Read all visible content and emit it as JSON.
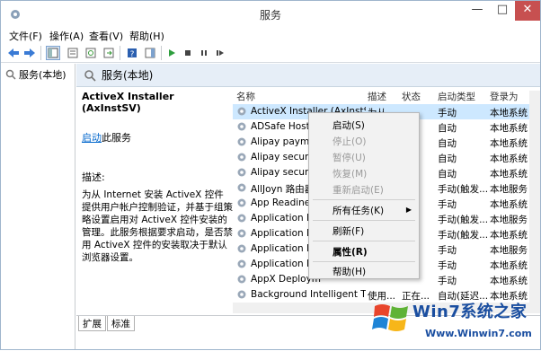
{
  "window": {
    "title": "服务",
    "min": "—",
    "max": "□",
    "close": "✕"
  },
  "menu": [
    "文件(F)",
    "操作(A)",
    "查看(V)",
    "帮助(H)"
  ],
  "tree": {
    "item": "服务(本地)"
  },
  "panel": {
    "header": "服务(本地)"
  },
  "details": {
    "service_title": "ActiveX Installer (AxInstSV)",
    "start_link": "启动",
    "start_suffix": "此服务",
    "desc_label": "描述:",
    "desc_text": "为从 Internet 安装 ActiveX 控件提供用户帐户控制验证，并基于组策略设置启用对 ActiveX 控件安装的管理。此服务根据要求启动，是否禁用 ActiveX 控件的安装取决于默认浏览器设置。"
  },
  "columns": {
    "name": "名称",
    "desc": "描述",
    "status": "状态",
    "startup": "启动类型",
    "logon": "登录为"
  },
  "rows": [
    {
      "name": "ActiveX Installer (AxInstSV)",
      "desc": "为从...",
      "status": "",
      "startup": "手动",
      "logon": "本地系统"
    },
    {
      "name": "ADSafe Host S",
      "desc": "",
      "status": "",
      "startup": "自动",
      "logon": "本地系统"
    },
    {
      "name": "Alipay paymer",
      "desc": "",
      "status": "",
      "startup": "自动",
      "logon": "本地系统"
    },
    {
      "name": "Alipay security",
      "desc": "",
      "status": "",
      "startup": "自动",
      "logon": "本地系统"
    },
    {
      "name": "Alipay security",
      "desc": "",
      "status": "",
      "startup": "自动",
      "logon": "本地系统"
    },
    {
      "name": "AllJoyn 路由器",
      "desc": "",
      "status": "",
      "startup": "手动(触发...",
      "logon": "本地服务"
    },
    {
      "name": "App Readines",
      "desc": "",
      "status": "",
      "startup": "手动",
      "logon": "本地系统"
    },
    {
      "name": "Application Id",
      "desc": "",
      "status": "",
      "startup": "手动(触发...",
      "logon": "本地服务"
    },
    {
      "name": "Application Inf",
      "desc": "",
      "status": "",
      "startup": "手动(触发...",
      "logon": "本地系统"
    },
    {
      "name": "Application La",
      "desc": "",
      "status": "",
      "startup": "手动",
      "logon": "本地服务"
    },
    {
      "name": "Application M",
      "desc": "",
      "status": "",
      "startup": "手动",
      "logon": "本地系统"
    },
    {
      "name": "AppX Deploym",
      "desc": "",
      "status": "",
      "startup": "手动",
      "logon": "本地系统"
    },
    {
      "name": "Background Intelligent T...",
      "desc": "使用...",
      "status": "正在...",
      "startup": "自动(延迟...",
      "logon": "本地系统"
    }
  ],
  "context_menu": {
    "start": "启动(S)",
    "stop": "停止(O)",
    "pause": "暂停(U)",
    "resume": "恢复(M)",
    "restart": "重新启动(E)",
    "all_tasks": "所有任务(K)",
    "refresh": "刷新(F)",
    "properties": "属性(R)",
    "help": "帮助(H)"
  },
  "tabs": [
    "扩展",
    "标准"
  ],
  "watermark": {
    "title": "Win7系统之家",
    "url": "Www.Winwin7.com"
  },
  "colors": {
    "selection": "#cde8ff",
    "header_bg": "#e6eef7",
    "link": "#0066cc",
    "close": "#c75050",
    "watermark": "#1a4ea0"
  }
}
